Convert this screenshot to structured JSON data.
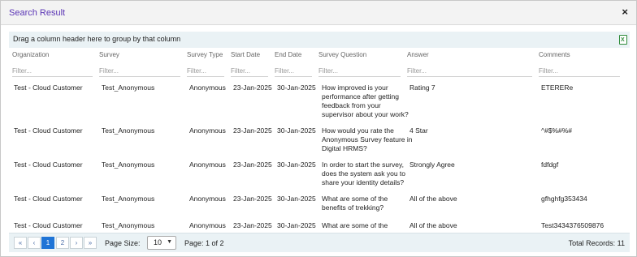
{
  "dialog": {
    "title": "Search Result",
    "close_glyph": "×"
  },
  "group_bar": {
    "text": "Drag a column header here to group by that column",
    "export_glyph": "X"
  },
  "columns": [
    {
      "label": "Organization",
      "filter_placeholder": "Filter..."
    },
    {
      "label": "Survey",
      "filter_placeholder": "Filter..."
    },
    {
      "label": "Survey Type",
      "filter_placeholder": "Filter..."
    },
    {
      "label": "Start Date",
      "filter_placeholder": "Filter..."
    },
    {
      "label": "End Date",
      "filter_placeholder": "Filter..."
    },
    {
      "label": "Survey Question",
      "filter_placeholder": "Filter..."
    },
    {
      "label": "Answer",
      "filter_placeholder": "Filter..."
    },
    {
      "label": "Comments",
      "filter_placeholder": "Filter..."
    }
  ],
  "rows": [
    {
      "organization": "Test - Cloud Customer",
      "survey": "Test_Anonymous",
      "survey_type": "Anonymous",
      "start_date": "23-Jan-2025",
      "end_date": "30-Jan-2025",
      "question_lines": [
        "How improved is your",
        "performance after getting",
        "feedback from your",
        "supervisor about your work?"
      ],
      "answer": "Rating 7",
      "comments": "ETERERe"
    },
    {
      "organization": "Test - Cloud Customer",
      "survey": "Test_Anonymous",
      "survey_type": "Anonymous",
      "start_date": "23-Jan-2025",
      "end_date": "30-Jan-2025",
      "question_lines": [
        "How would you rate the",
        "Anonymous Survey feature in",
        "Digital HRMS?"
      ],
      "answer": "4 Star",
      "comments": "^#$%#%#"
    },
    {
      "organization": "Test - Cloud Customer",
      "survey": "Test_Anonymous",
      "survey_type": "Anonymous",
      "start_date": "23-Jan-2025",
      "end_date": "30-Jan-2025",
      "question_lines": [
        "In order to start the survey,",
        "does the system ask you to",
        "share your identity details?"
      ],
      "answer": "Strongly Agree",
      "comments": "fdfdgf"
    },
    {
      "organization": "Test - Cloud Customer",
      "survey": "Test_Anonymous",
      "survey_type": "Anonymous",
      "start_date": "23-Jan-2025",
      "end_date": "30-Jan-2025",
      "question_lines": [
        "What are some of the",
        "benefits of trekking?"
      ],
      "answer": "All of the above",
      "comments": "gfhghfg353434"
    },
    {
      "organization": "Test - Cloud Customer",
      "survey": "Test_Anonymous",
      "survey_type": "Anonymous",
      "start_date": "23-Jan-2025",
      "end_date": "30-Jan-2025",
      "question_lines": [
        "What are some of the"
      ],
      "answer": "All of the above",
      "comments": "Test3434376509876"
    }
  ],
  "pager": {
    "first": "«",
    "prev": "‹",
    "pages": [
      "1",
      "2"
    ],
    "current_page": "1",
    "next": "›",
    "last": "»",
    "page_size_label": "Page Size:",
    "page_size_value": "10",
    "page_info": "Page: 1 of 2",
    "total_records": "Total Records: 11"
  }
}
